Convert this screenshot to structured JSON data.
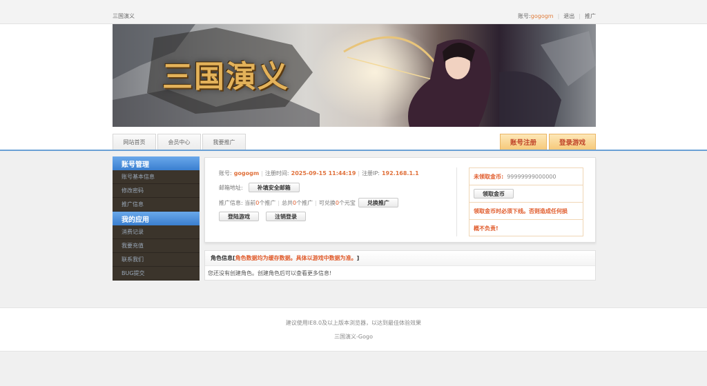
{
  "topbar": {
    "site_name": "三国演义",
    "account_label": "账号:",
    "username": "gogogm",
    "logout": "退出",
    "promote": "推广"
  },
  "banner": {
    "logo_text": "三国演义"
  },
  "nav": {
    "tabs": [
      "网站首页",
      "会员中心",
      "我要推广"
    ],
    "register": "账号注册",
    "login_game": "登录游戏"
  },
  "sidebar": {
    "section1_title": "账号管理",
    "section1_items": [
      "账号基本信息",
      "修改密码",
      "推广信息"
    ],
    "section2_title": "我的应用",
    "section2_items": [
      "消费记录",
      "我要充值",
      "联系我们",
      "BUG提交"
    ]
  },
  "account": {
    "label_account": "账号:",
    "username": "gogogm",
    "label_regtime": "注册时间:",
    "regtime": "2025-09-15 11:44:19",
    "label_regip": "注册IP:",
    "regip": "192.168.1.1",
    "label_email": "邮箱地址:",
    "btn_email": "补填安全邮箱",
    "promo_label": "推广信息: 当前",
    "promo_current": "0",
    "promo_mid1": "个推广",
    "promo_total_label": "总共",
    "promo_total": "0",
    "promo_mid2": "个推广",
    "promo_exchange_label": "可兑换",
    "promo_exchange": "0",
    "promo_unit": "个元宝",
    "btn_exchange": "兑换推广",
    "btn_login_game": "登陆游戏",
    "btn_logout": "注销登录"
  },
  "gold": {
    "label": "未领取金币:",
    "value": "99999999000000",
    "btn_claim": "领取金币",
    "warn1": "领取金币时必须下线。否则造成任何损",
    "warn2": "概不负责!"
  },
  "role": {
    "title_prefix": "角色信息[",
    "title_highlight": "角色数据均为缓存数据。具体以游戏中数据为准。",
    "title_suffix": "]",
    "empty_text": "您还没有创建角色。创建角色后可以查看更多信息!"
  },
  "footer": {
    "line1": "建议使用IE8.0及以上版本浏览器，以达到最佳体验效果",
    "line2": "三国演义-Gogo"
  }
}
